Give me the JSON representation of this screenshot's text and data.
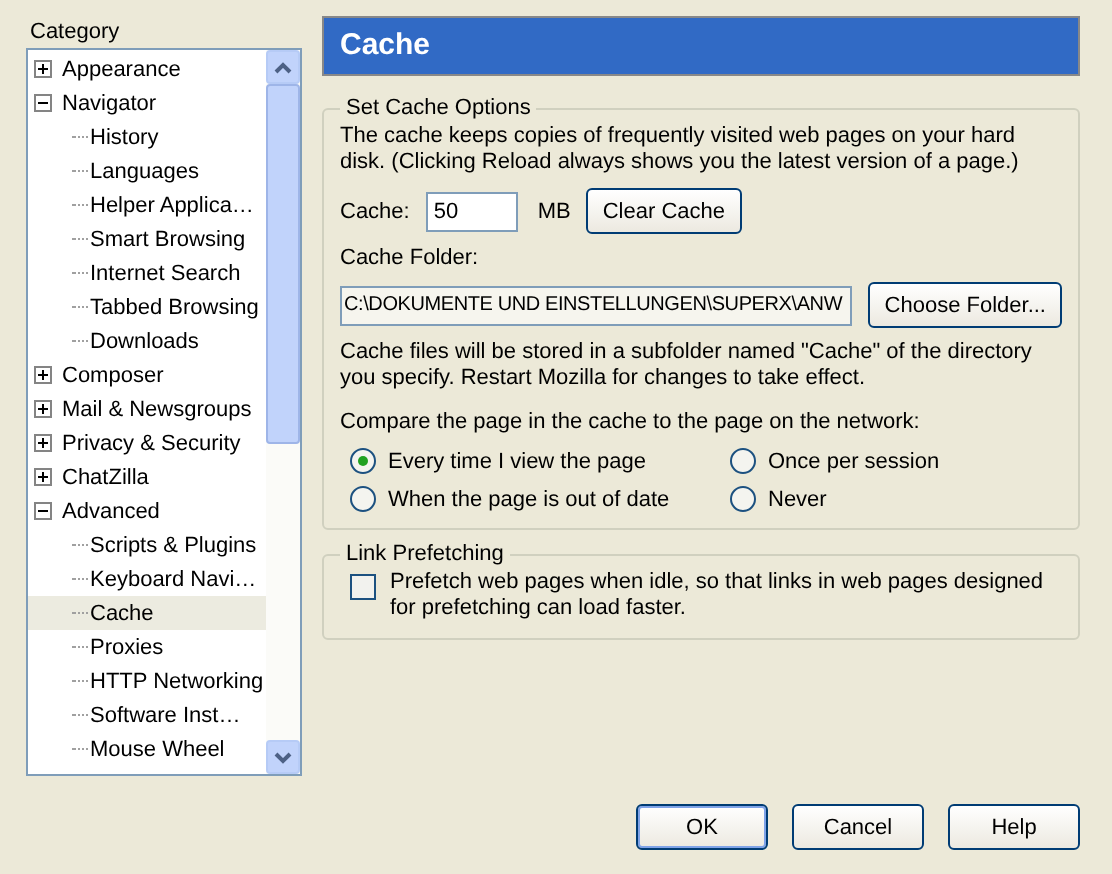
{
  "category_label": "Category",
  "tree": [
    {
      "label": "Appearance",
      "expanded": false,
      "selected": false
    },
    {
      "label": "Navigator",
      "expanded": true,
      "selected": false,
      "children": [
        {
          "label": "History",
          "selected": false
        },
        {
          "label": "Languages",
          "selected": false
        },
        {
          "label": "Helper Applica…",
          "selected": false
        },
        {
          "label": "Smart Browsing",
          "selected": false
        },
        {
          "label": "Internet Search",
          "selected": false
        },
        {
          "label": "Tabbed Browsing",
          "selected": false
        },
        {
          "label": "Downloads",
          "selected": false
        }
      ]
    },
    {
      "label": "Composer",
      "expanded": false,
      "selected": false
    },
    {
      "label": "Mail & Newsgroups",
      "expanded": false,
      "selected": false
    },
    {
      "label": "Privacy & Security",
      "expanded": false,
      "selected": false
    },
    {
      "label": "ChatZilla",
      "expanded": false,
      "selected": false
    },
    {
      "label": "Advanced",
      "expanded": true,
      "selected": false,
      "children": [
        {
          "label": "Scripts & Plugins",
          "selected": false
        },
        {
          "label": "Keyboard Navi…",
          "selected": false
        },
        {
          "label": "Cache",
          "selected": true
        },
        {
          "label": "Proxies",
          "selected": false
        },
        {
          "label": "HTTP Networking",
          "selected": false
        },
        {
          "label": "Software Inst…",
          "selected": false
        },
        {
          "label": "Mouse Wheel",
          "selected": false
        }
      ]
    }
  ],
  "header": "Cache",
  "cache_group": {
    "legend": "Set Cache Options",
    "intro": "The cache keeps copies of frequently visited web pages on your hard disk. (Clicking Reload always shows you the latest version of a page.)",
    "cache_label": "Cache:",
    "cache_value": "50",
    "unit": "MB",
    "clear_button": "Clear Cache",
    "folder_label": "Cache Folder:",
    "folder_value": "C:\\DOKUMENTE UND EINSTELLUNGEN\\SUPERX\\ANW",
    "choose_button": "Choose Folder...",
    "folder_note": "Cache files will be stored in a subfolder named \"Cache\" of the directory you specify. Restart Mozilla for changes to take effect.",
    "compare_label": "Compare the page in the cache to the page on the network:",
    "options": [
      {
        "label": "Every time I view the page",
        "selected": true
      },
      {
        "label": "Once per session",
        "selected": false
      },
      {
        "label": "When the page is out of date",
        "selected": false
      },
      {
        "label": "Never",
        "selected": false
      }
    ]
  },
  "prefetch_group": {
    "legend": "Link Prefetching",
    "label": "Prefetch web pages when idle, so that links in web pages designed for prefetching can load faster.",
    "checked": false
  },
  "buttons": [
    {
      "label": "OK",
      "default": true
    },
    {
      "label": "Cancel",
      "default": false
    },
    {
      "label": "Help",
      "default": false
    }
  ]
}
